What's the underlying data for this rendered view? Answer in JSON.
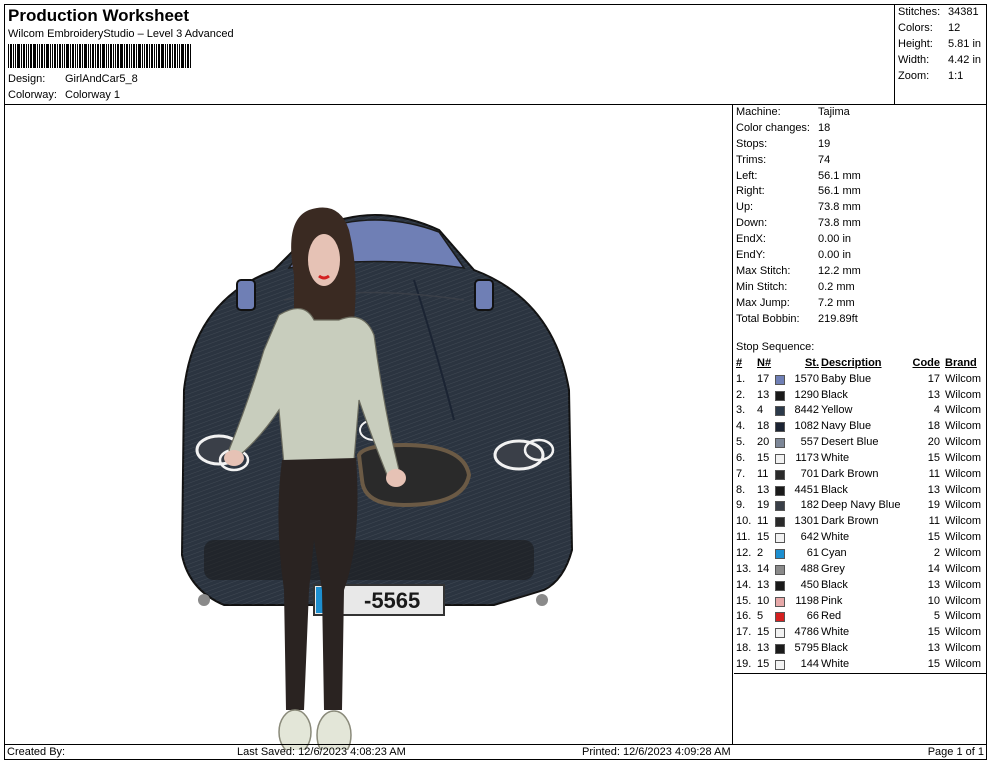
{
  "header": {
    "title": "Production Worksheet",
    "software": "Wilcom EmbroideryStudio – Level 3 Advanced",
    "design_label": "Design:",
    "design_value": "GirlAndCar5_8",
    "colorway_label": "Colorway:",
    "colorway_value": "Colorway 1"
  },
  "summary": [
    {
      "label": "Stitches:",
      "value": "34381"
    },
    {
      "label": "Colors:",
      "value": "12"
    },
    {
      "label": "Height:",
      "value": "5.81 in"
    },
    {
      "label": "Width:",
      "value": "4.42 in"
    },
    {
      "label": "Zoom:",
      "value": "1:1"
    }
  ],
  "stats": [
    {
      "label": "Machine:",
      "value": "Tajima"
    },
    {
      "label": "Color changes:",
      "value": "18"
    },
    {
      "label": "Stops:",
      "value": "19"
    },
    {
      "label": "Trims:",
      "value": "74"
    },
    {
      "label": "Left:",
      "value": "56.1 mm"
    },
    {
      "label": "Right:",
      "value": "56.1 mm"
    },
    {
      "label": "Up:",
      "value": "73.8 mm"
    },
    {
      "label": "Down:",
      "value": "73.8 mm"
    },
    {
      "label": "EndX:",
      "value": "0.00 in"
    },
    {
      "label": "EndY:",
      "value": "0.00 in"
    },
    {
      "label": "Max Stitch:",
      "value": "12.2 mm"
    },
    {
      "label": "Min Stitch:",
      "value": "0.2 mm"
    },
    {
      "label": "Max Jump:",
      "value": "7.2 mm"
    },
    {
      "label": "Total Bobbin:",
      "value": "219.89ft"
    }
  ],
  "sequence": {
    "title": "Stop Sequence:",
    "headers": {
      "num": "#",
      "n": "N#",
      "st": "St.",
      "desc": "Description",
      "code": "Code",
      "brand": "Brand"
    },
    "rows": [
      {
        "num": "1.",
        "n": "17",
        "color": "#6f7fb5",
        "st": "1570",
        "desc": "Baby Blue",
        "code": "17",
        "brand": "Wilcom"
      },
      {
        "num": "2.",
        "n": "13",
        "color": "#1a1a1a",
        "st": "1290",
        "desc": "Black",
        "code": "13",
        "brand": "Wilcom"
      },
      {
        "num": "3.",
        "n": "4",
        "color": "#2c3a4a",
        "st": "8442",
        "desc": "Yellow",
        "code": "4",
        "brand": "Wilcom"
      },
      {
        "num": "4.",
        "n": "18",
        "color": "#1b2433",
        "st": "1082",
        "desc": "Navy Blue",
        "code": "18",
        "brand": "Wilcom"
      },
      {
        "num": "5.",
        "n": "20",
        "color": "#7d8797",
        "st": "557",
        "desc": "Desert Blue",
        "code": "20",
        "brand": "Wilcom"
      },
      {
        "num": "6.",
        "n": "15",
        "color": "#f2f2f2",
        "st": "1173",
        "desc": "White",
        "code": "15",
        "brand": "Wilcom"
      },
      {
        "num": "7.",
        "n": "11",
        "color": "#2a2a2a",
        "st": "701",
        "desc": "Dark Brown",
        "code": "11",
        "brand": "Wilcom"
      },
      {
        "num": "8.",
        "n": "13",
        "color": "#1a1a1a",
        "st": "4451",
        "desc": "Black",
        "code": "13",
        "brand": "Wilcom"
      },
      {
        "num": "9.",
        "n": "19",
        "color": "#3a3f48",
        "st": "182",
        "desc": "Deep Navy Blue",
        "code": "19",
        "brand": "Wilcom"
      },
      {
        "num": "10.",
        "n": "11",
        "color": "#2a2a2a",
        "st": "1301",
        "desc": "Dark Brown",
        "code": "11",
        "brand": "Wilcom"
      },
      {
        "num": "11.",
        "n": "15",
        "color": "#f2f2f2",
        "st": "642",
        "desc": "White",
        "code": "15",
        "brand": "Wilcom"
      },
      {
        "num": "12.",
        "n": "2",
        "color": "#1d8fd0",
        "st": "61",
        "desc": "Cyan",
        "code": "2",
        "brand": "Wilcom"
      },
      {
        "num": "13.",
        "n": "14",
        "color": "#8a8a8a",
        "st": "488",
        "desc": "Grey",
        "code": "14",
        "brand": "Wilcom"
      },
      {
        "num": "14.",
        "n": "13",
        "color": "#1a1a1a",
        "st": "450",
        "desc": "Black",
        "code": "13",
        "brand": "Wilcom"
      },
      {
        "num": "15.",
        "n": "10",
        "color": "#e6a8a8",
        "st": "1198",
        "desc": "Pink",
        "code": "10",
        "brand": "Wilcom"
      },
      {
        "num": "16.",
        "n": "5",
        "color": "#d42020",
        "st": "66",
        "desc": "Red",
        "code": "5",
        "brand": "Wilcom"
      },
      {
        "num": "17.",
        "n": "15",
        "color": "#f2f2f2",
        "st": "4786",
        "desc": "White",
        "code": "15",
        "brand": "Wilcom"
      },
      {
        "num": "18.",
        "n": "13",
        "color": "#1a1a1a",
        "st": "5795",
        "desc": "Black",
        "code": "13",
        "brand": "Wilcom"
      },
      {
        "num": "19.",
        "n": "15",
        "color": "#f2f2f2",
        "st": "144",
        "desc": "White",
        "code": "15",
        "brand": "Wilcom"
      }
    ]
  },
  "design_preview": {
    "plate_text": "-5565",
    "car_color": "#2b3440",
    "hair_color": "#3a2a22",
    "top_color": "#c8cdbd",
    "pants_color": "#2a2321"
  },
  "footer": {
    "created_by": "Created By:",
    "last_saved": "Last Saved: 12/6/2023 4:08:23 AM",
    "printed": "Printed: 12/6/2023 4:09:28 AM",
    "page": "Page 1 of 1"
  }
}
